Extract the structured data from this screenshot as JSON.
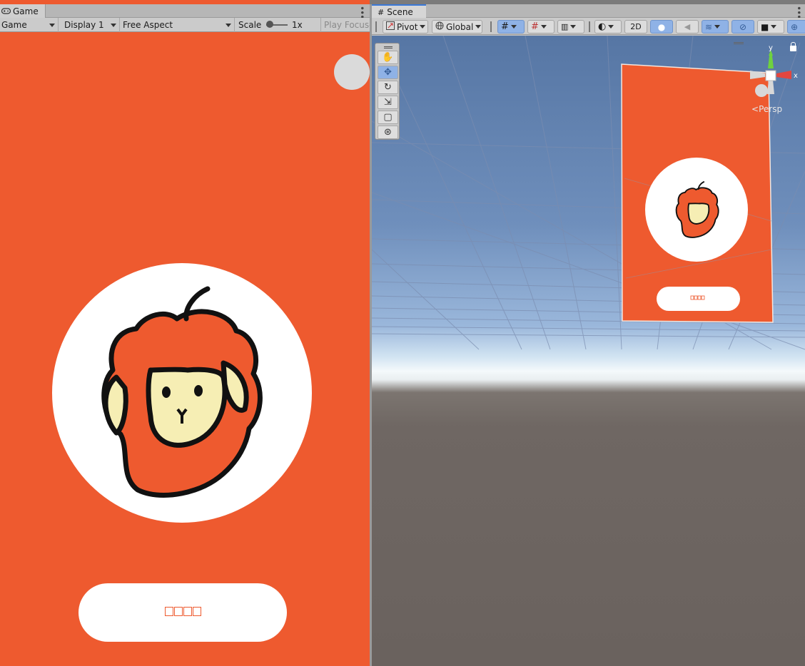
{
  "game_window": {
    "tab_label": "Game",
    "mode_dropdown": "Game",
    "display_dropdown": "Display 1",
    "aspect_dropdown": "Free Aspect",
    "scale_label": "Scale",
    "scale_value": "1x",
    "play_focused_label": "Play Focused",
    "canvas": {
      "background_color": "#ee5a2f",
      "logo_icon": "monkey-apple-logo",
      "button_text": "□□□□"
    }
  },
  "scene_window": {
    "tab_label": "Scene",
    "pivot_label": "Pivot",
    "global_label": "Global",
    "mode_2d_label": "2D",
    "axis_labels": {
      "y": "y",
      "x": "x"
    },
    "persp_label": "Persp",
    "preview_button_text": "□□□□",
    "tools": [
      "hand-tool-icon",
      "move-tool-icon",
      "rotate-tool-icon",
      "scale-tool-icon",
      "rect-tool-icon",
      "transform-tool-icon"
    ]
  },
  "colors": {
    "brand_orange": "#ee5a2f",
    "selection_blue": "#8fb2e6",
    "axis_y": "#6fd13f",
    "axis_x": "#e3463f"
  }
}
